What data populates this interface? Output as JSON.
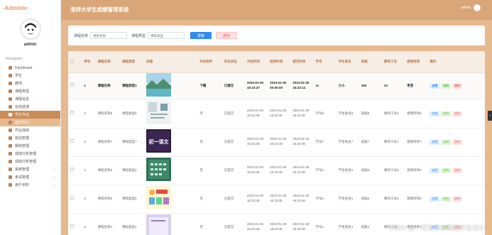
{
  "brand": "Adminto",
  "user": {
    "name": "admin"
  },
  "header": {
    "title": "淮师大学生成绩管理系统",
    "user_label": "admin"
  },
  "nav": {
    "section": "Navigation",
    "items": [
      {
        "label": "Dashboard"
      },
      {
        "label": "学生"
      },
      {
        "label": "教师"
      },
      {
        "label": "课程类型"
      },
      {
        "label": "课程信息"
      },
      {
        "label": "在线选课"
      },
      {
        "label": "学生作业"
      },
      {
        "label": "提交作业"
      },
      {
        "label": "作业成绩"
      },
      {
        "label": "班别管理"
      },
      {
        "label": "期目管理"
      },
      {
        "label": "成绩分析管理"
      },
      {
        "label": "成绩分析管理"
      },
      {
        "label": "系统管理"
      },
      {
        "label": "考试管理"
      },
      {
        "label": "用户资料"
      }
    ]
  },
  "search": {
    "course_name_label": "课程名称",
    "course_name_placeholder": "课程名称",
    "course_type_label": "课程类型",
    "course_type_placeholder": "课程类型",
    "search_button": "搜索",
    "delete_button": "删除"
  },
  "table": {
    "columns": [
      "",
      "序号",
      "课程名称",
      "课程类型",
      "封面",
      "作业附件",
      "作业状态",
      "开始时间",
      "结束时间",
      "提交时间",
      "学号",
      "学生姓名",
      "班级",
      "教师工号",
      "授课老师",
      "操作"
    ],
    "rows": [
      {
        "idx": "1",
        "name": "课程名称",
        "type": "课程类型3",
        "attach": "下载",
        "status": "已提交",
        "start": "2024-01-29 16:23:27",
        "end": "2024-01-30 00:00:00",
        "submit": "2024-01-29 16:23:14",
        "sno": "11",
        "sname": "小小",
        "cls": "305",
        "tno": "22",
        "teacher": "李芸"
      },
      {
        "idx": "2",
        "name": "课程名称8",
        "type": "课程类型8",
        "attach": "无",
        "status": "已提交",
        "start": "2024-01-29 16:23:48",
        "end": "2024-01-29 16:23:48",
        "submit": "2024-01-29 16:23:48",
        "sno": "学号8",
        "sname": "学生姓名8",
        "cls": "班级8",
        "tno": "教师工号8",
        "teacher": "授课老师8"
      },
      {
        "idx": "3",
        "name": "课程名称7",
        "type": "课程类型7",
        "attach": "无",
        "status": "已提交",
        "start": "2024-01-29 16:23:48",
        "end": "2024-01-29 16:23:48",
        "submit": "2024-01-29 16:23:48",
        "sno": "学号7",
        "sname": "学生姓名7",
        "cls": "班级7",
        "tno": "教师工号7",
        "teacher": "授课老师7"
      },
      {
        "idx": "4",
        "name": "课程名称6",
        "type": "课程类型6",
        "attach": "无",
        "status": "已提交",
        "start": "2024-01-29 16:23:48",
        "end": "2024-01-29 16:23:48",
        "submit": "2024-01-29 16:23:48",
        "sno": "学号6",
        "sname": "学生姓名6",
        "cls": "班级6",
        "tno": "教师工号6",
        "teacher": "授课老师6"
      },
      {
        "idx": "5",
        "name": "课程名称5",
        "type": "课程类型5",
        "attach": "无",
        "status": "已提交",
        "start": "2024-01-29 16:23:48",
        "end": "2024-01-29 16:23:48",
        "submit": "2024-01-29 16:23:48",
        "sno": "学号5",
        "sname": "学生姓名5",
        "cls": "班级5",
        "tno": "教师工号5",
        "teacher": "授课老师5"
      },
      {
        "idx": "6",
        "name": "课程名称4",
        "type": "课程类型4",
        "attach": "无",
        "status": "已提交",
        "start": "2024-01-29 16:23:48",
        "end": "2024-01-29 16:23:48",
        "submit": "2024-01-29 16:23:48",
        "sno": "学号4",
        "sname": "学生姓名4",
        "cls": "班级4",
        "tno": "教师工号4",
        "teacher": "授课老师4"
      }
    ],
    "ops": {
      "view": "查看",
      "edit": "修改",
      "delete": "删除"
    },
    "cover3_text": "初一语文"
  },
  "watermark": "CSDN @一花学长计算机毕业设计",
  "colors": {
    "header": "#d9a678",
    "accent": "#c98c55",
    "primary": "#2d8cf0"
  }
}
